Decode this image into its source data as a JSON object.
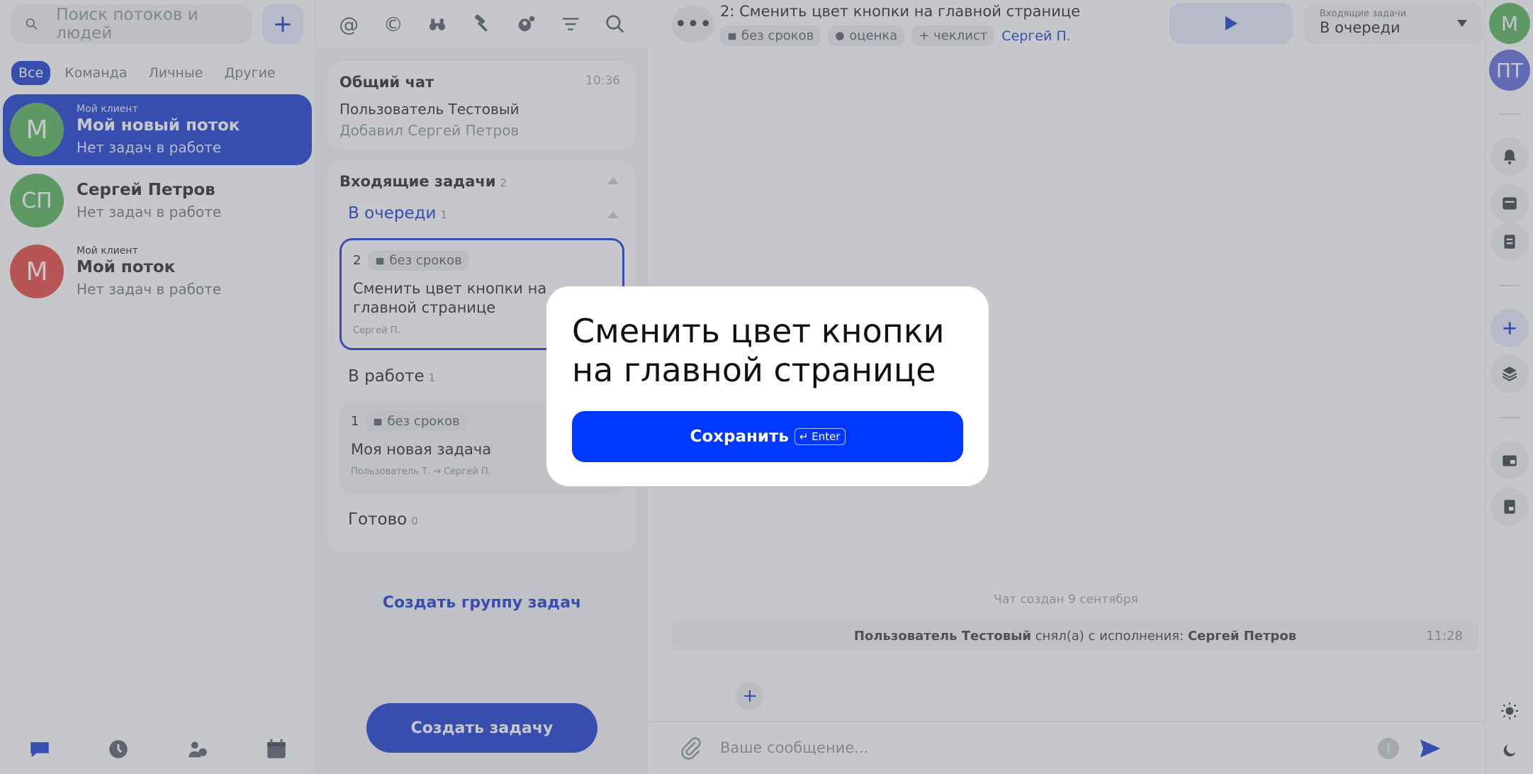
{
  "colors": {
    "accent": "#0b2fcf",
    "modal_button": "#0038ff",
    "green": "#4caf50",
    "red": "#e53935",
    "purple": "#5560d8"
  },
  "left": {
    "search_placeholder": "Поиск потоков и людей",
    "add_label": "+",
    "filters": [
      "Все",
      "Команда",
      "Личные",
      "Другие"
    ],
    "streams": [
      {
        "tag": "Мой клиент",
        "initial": "М",
        "name": "Мой новый поток",
        "sub": "Нет задач в работе"
      },
      {
        "tag": "",
        "initial": "СП",
        "name": "Сергей Петров",
        "sub": "Нет задач в работе"
      },
      {
        "tag": "Мой клиент",
        "initial": "М",
        "name": "Мой поток",
        "sub": "Нет задач в работе"
      }
    ],
    "bottom_icons": [
      "chat-icon",
      "clock-icon",
      "contacts-icon",
      "calendar-icon"
    ]
  },
  "middle": {
    "tool_icons": [
      "at-icon",
      "copyright-icon",
      "binoculars-icon",
      "hammer-icon",
      "gear-person-icon",
      "filter-icon",
      "search-icon"
    ],
    "chat": {
      "title": "Общий чат",
      "time": "10:36",
      "line1": "Пользователь Тестовый",
      "line2": "Добавил Сергей Петров"
    },
    "tasks": {
      "title": "Входящие задачи",
      "count": "2",
      "groups": [
        {
          "name": "В очереди",
          "count": "1"
        },
        {
          "name": "В работе",
          "count": "1"
        },
        {
          "name": "Готово",
          "count": "0"
        }
      ],
      "items": [
        {
          "num": "2",
          "deadline": "без сроков",
          "title": "Сменить цвет кнопки на главной странице",
          "who": "Сергей П."
        },
        {
          "num": "1",
          "deadline": "без сроков",
          "title": "Моя новая задача",
          "who": "Пользователь Т. → Сергей П."
        }
      ]
    },
    "create_group": "Создать группу задач",
    "create_task": "Создать задачу"
  },
  "main": {
    "dots": "•••",
    "task_title": "2: Сменить цвет кнопки на главной странице",
    "meta": {
      "deadline": "без сроков",
      "estimate": "оценка",
      "checklist": "+ чеклист",
      "person": "Сергей П."
    },
    "status": {
      "label": "Входящие задачи",
      "value": "В очереди"
    },
    "chat_created": "Чат создан 9 сентября",
    "event": {
      "actor": "Пользователь Тестовый",
      "action": " снял(а) с исполнения: ",
      "target": "Сергей Петров",
      "time": "11:28"
    },
    "plus": "+",
    "composer_placeholder": "Ваше сообщение...",
    "info": "i"
  },
  "rail": {
    "avatar1": "М",
    "avatar2": "ПТ"
  },
  "modal": {
    "title": "Сменить цвет кнопки на главной странице",
    "save_label": "Сохранить",
    "kbd": "↵ Enter"
  }
}
